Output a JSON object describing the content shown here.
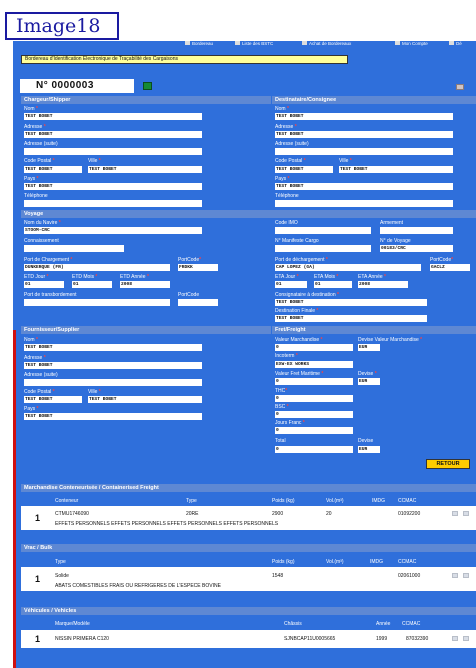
{
  "badge": "Image18",
  "topmenu": [
    "Bordereau",
    "Liste des BSTC",
    "Achat de Bordereaux",
    "Mon Compte",
    "Dé"
  ],
  "banner": "Bordereau d'Identification Electronique de Traçabilité des Cargaisons",
  "doc_number": "N° 0000003",
  "shipper": {
    "title": "Chargeur/Shipper",
    "nom_label": "Nom",
    "nom": "TEST BOBET",
    "adresse_label": "Adresse",
    "adresse": "TEST BOBET",
    "adresse_suite_label": "Adresse (suite)",
    "code_postal_label": "Code Postal",
    "code_postal": "TEST BOBET",
    "ville_label": "Ville",
    "ville": "TEST BOBET",
    "pays_label": "Pays",
    "pays": "TEST BOBET",
    "telephone_label": "Téléphone"
  },
  "consignee": {
    "title": "Destinataire/Consignee",
    "nom_label": "Nom",
    "nom": "TEST BOBET",
    "adresse_label": "Adresse",
    "adresse": "TEST BOBET",
    "adresse_suite_label": "Adresse (suite)",
    "code_postal_label": "Code Postal",
    "code_postal": "TEST BOBET",
    "ville_label": "Ville",
    "ville": "TEST BOBET",
    "pays_label": "Pays",
    "pays": "TEST BOBET",
    "telephone_label": "Téléphone"
  },
  "voyage": {
    "title": "Voyage",
    "navire_label": "Nom du Navire",
    "navire": "STOOM-CRC",
    "code_imo_label": "Code IMO",
    "armement_label": "Armement",
    "connaissement_label": "Connaissement",
    "manifeste_label": "N° Manifeste Cargo",
    "no_voyage_label": "N° de Voyage",
    "no_voyage": "00183/CRC",
    "port_chargement_label": "Port de Chargement",
    "port_chargement": "DUNKERQUE (FR)",
    "portcode1_label": "PortCode",
    "portcode1": "FRDKK",
    "port_dechargement_label": "Port de déchargement",
    "port_dechargement": "CAP LOPEZ (GA)",
    "portcode2_label": "PortCode",
    "portcode2": "GACLZ",
    "etd_jour_label": "ETD Jour",
    "etd_jour": "01",
    "etd_mois_label": "ETD Mois",
    "etd_mois": "01",
    "etd_annee_label": "ETD Année",
    "etd_annee": "2008",
    "eta_jour_label": "ETA Jour",
    "eta_jour": "01",
    "eta_mois_label": "ETA Mois",
    "eta_mois": "01",
    "eta_annee_label": "ETA Année",
    "eta_annee": "2008",
    "transbordement_label": "Port de transbordement",
    "portcode3_label": "PortCode",
    "consignataire_label": "Consignataire à destination",
    "consignataire": "TEST BOBET",
    "destination_finale_label": "Destination Finale",
    "destination_finale": "TEST BOBET"
  },
  "supplier": {
    "title": "Fournisseur/Supplier",
    "nom_label": "Nom",
    "nom": "TEST BOBET",
    "adresse_label": "Adresse",
    "adresse": "TEST BOBET",
    "adresse_suite_label": "Adresse (suite)",
    "code_postal_label": "Code Postal",
    "code_postal": "TEST BOBET",
    "ville_label": "Ville",
    "ville": "TEST BOBET",
    "pays_label": "Pays",
    "pays": "TEST BOBET"
  },
  "freight": {
    "title": "Fret/Freight",
    "valeur_label": "Valeur Marchandise",
    "valeur": "0",
    "devise_valeur_label": "Devise Valeur Marchandise",
    "devise_valeur": "EUR",
    "incoterm_label": "Incoterm",
    "incoterm": "EXW-EX WORKS",
    "valeur_fret_label": "Valeur Fret Maritime",
    "valeur_fret": "0",
    "devise_fret_label": "Devise",
    "devise_fret": "EUR",
    "thc_label": "THC",
    "thc": "0",
    "bsc_label": "BSC",
    "bsc": "0",
    "jours_franc_label": "Jours Franc",
    "jours_franc": "0",
    "total_label": "Total",
    "total": "0",
    "devise_total_label": "Devise",
    "devise_total": "EUR"
  },
  "retour_label": "RETOUR",
  "containers": {
    "title": "Marchandise Conteneurisée / Containerised Freight",
    "headers": [
      "Conteneur",
      "Type",
      "Poids (kg)",
      "Vol.(m³)",
      "IMDG",
      "CCMAC"
    ],
    "row_number": "1",
    "row": [
      "CTMU1746090",
      "20RE",
      "2900",
      "20",
      "",
      "01092200"
    ],
    "desc": "EFFETS PERSONNELS EFFETS PERSONNELS EFFETS PERSONNELS EFFETS PERSONNELS"
  },
  "bulk": {
    "title": "Vrac / Bulk",
    "headers": [
      "Type",
      "Poids (kg)",
      "Vol.(m³)",
      "IMDG",
      "CCMAC"
    ],
    "row_number": "1",
    "row": [
      "Solide",
      "1548",
      "",
      "",
      "02061000"
    ],
    "desc": "ABATS COMESTIBLES FRAIS OU REFRIGERES DE L'ESPECE BOVINE"
  },
  "vehicles": {
    "title": "Véhicules / Vehicles",
    "headers": [
      "Marque/Modèle",
      "Châssis",
      "Année",
      "CCMAC"
    ],
    "row_number": "1",
    "row": [
      "NISSIN PRIMERA C120",
      "SJNBCAP11U0005665",
      "1999",
      "87032390"
    ]
  },
  "colors": {
    "page_bg": "#2f6fdb",
    "section_bar": "#5e88d3",
    "banner_bg": "#ffff99",
    "retour_bg": "#ffcc00",
    "badge_border": "#1a1aa0",
    "badge_text": "#1a1aa0"
  }
}
